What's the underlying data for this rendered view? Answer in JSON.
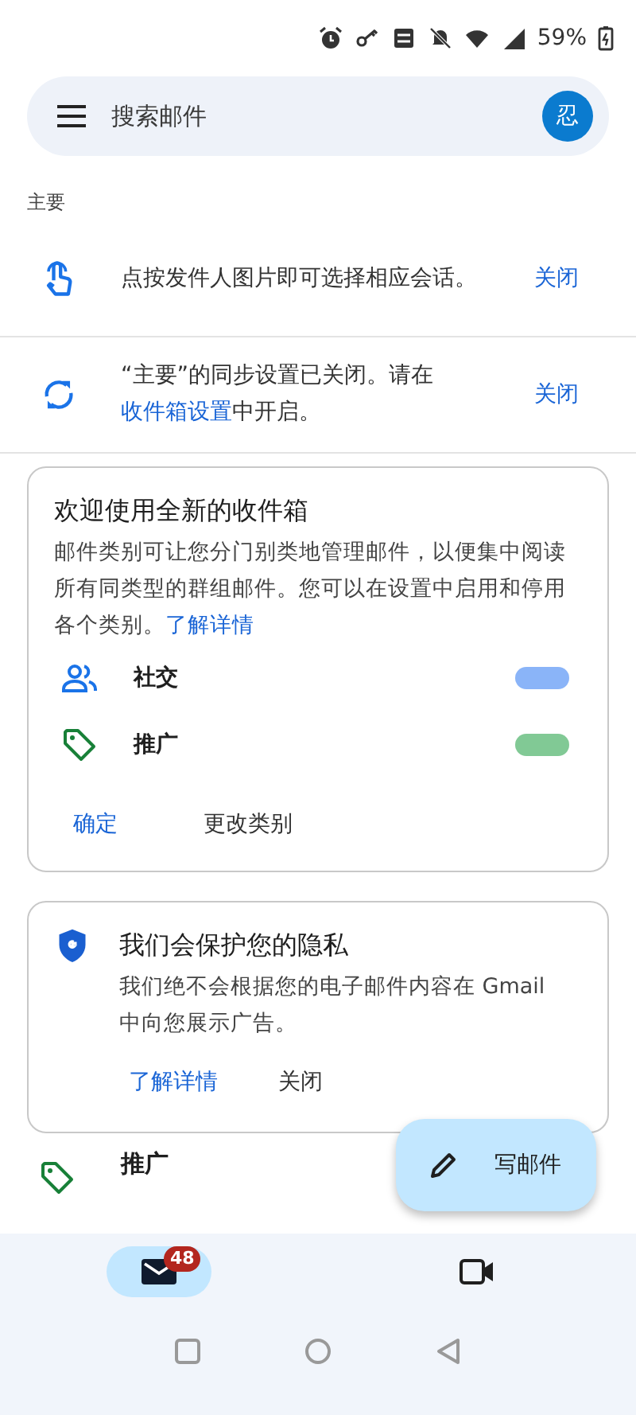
{
  "status_bar": {
    "battery": "59%"
  },
  "search": {
    "placeholder": "搜索邮件",
    "avatar": "忍"
  },
  "section_label": "主要",
  "tips": [
    {
      "kind": "touch",
      "text": "点按发件人图片即可选择相应会话。",
      "action": "关闭"
    },
    {
      "kind": "sync",
      "text": "“主要”的同步设置已关闭。请在",
      "link": "收件箱设置",
      "text_after": "中开启。",
      "action": "关闭"
    }
  ],
  "welcome_card": {
    "title": "欢迎使用全新的收件箱",
    "body": "邮件类别可让您分门别类地管理邮件，以便集中阅读所有同类型的群组邮件。您可以在设置中启用和停用各个类别。",
    "link": "了解详情",
    "categories": [
      {
        "kind": "people",
        "label": "社交",
        "color": "#8ab4f8"
      },
      {
        "kind": "tag",
        "label": "推广",
        "color": "#81c995"
      }
    ],
    "buttons": [
      "确定",
      "更改类别"
    ]
  },
  "privacy_card": {
    "title": "我们会保护您的隐私",
    "body": "我们绝不会根据您的电子邮件内容在 Gmail 中向您展示广告。",
    "buttons": [
      "了解详情",
      "关闭"
    ]
  },
  "list_item": {
    "kind": "tag",
    "label": "推广"
  },
  "fab": {
    "label": "写邮件"
  },
  "bottom_nav": [
    {
      "kind": "mail",
      "selected": true,
      "badge": "48"
    },
    {
      "kind": "video",
      "selected": false
    }
  ]
}
